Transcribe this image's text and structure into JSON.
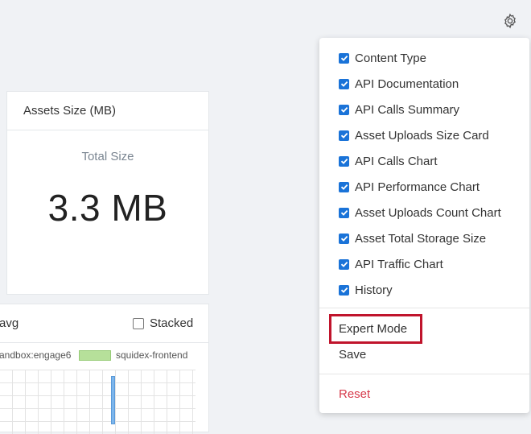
{
  "assets_card": {
    "title": "Assets Size (MB)",
    "label": "Total Size",
    "value": "3.3 MB"
  },
  "chart_card": {
    "title": "avg",
    "stacked_label": "Stacked",
    "legend_left": "andbox:engage6",
    "legend_series": "squidex-frontend"
  },
  "menu": {
    "items": [
      {
        "label": "Content Type",
        "checked": true
      },
      {
        "label": "API Documentation",
        "checked": true
      },
      {
        "label": "API Calls Summary",
        "checked": true
      },
      {
        "label": "Asset Uploads Size Card",
        "checked": true
      },
      {
        "label": "API Calls Chart",
        "checked": true
      },
      {
        "label": "API Performance Chart",
        "checked": true
      },
      {
        "label": "Asset Uploads Count Chart",
        "checked": true
      },
      {
        "label": "Asset Total Storage Size",
        "checked": true
      },
      {
        "label": "API Traffic Chart",
        "checked": true
      },
      {
        "label": "History",
        "checked": true
      }
    ],
    "expert_mode": "Expert Mode",
    "save": "Save",
    "reset": "Reset"
  },
  "colors": {
    "checkbox": "#1a73d8",
    "reset": "#d6394a",
    "highlight": "#c0142c"
  }
}
